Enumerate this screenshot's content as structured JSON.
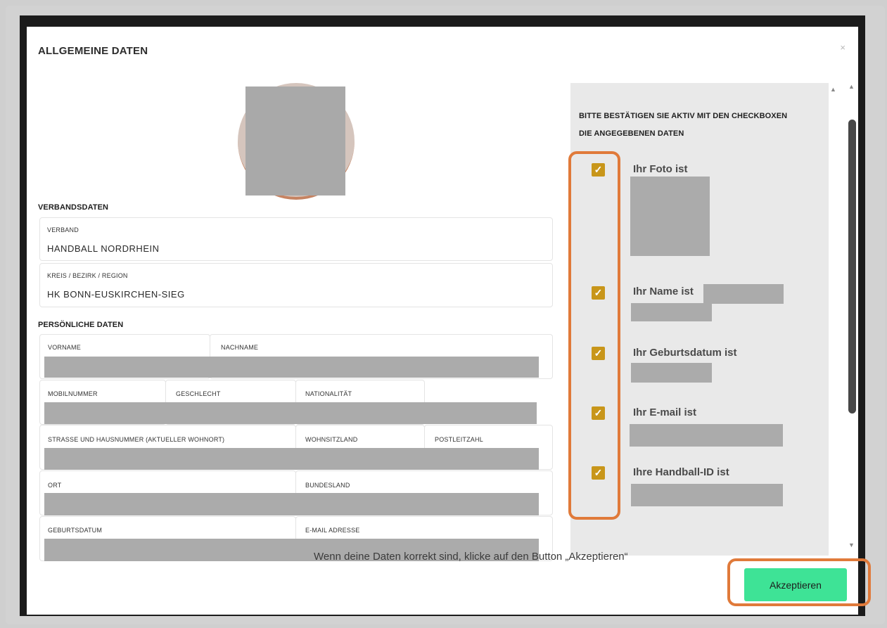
{
  "dialog": {
    "title": "ALLGEMEINE DATEN",
    "close_label": "×"
  },
  "verbandsdaten": {
    "heading": "VERBANDSDATEN",
    "verband_label": "VERBAND",
    "verband_value": "HANDBALL NORDRHEIN",
    "kreis_label": "KREIS / BEZIRK / REGION",
    "kreis_value": "HK BONN-EUSKIRCHEN-SIEG"
  },
  "persoenlich": {
    "heading": "PERSÖNLICHE DATEN",
    "vorname": "VORNAME",
    "nachname": "NACHNAME",
    "mobil": "MOBILNUMMER",
    "geschlecht": "GESCHLECHT",
    "nationalitaet": "NATIONALITÄT",
    "strasse": "STRASSE UND HAUSNUMMER (AKTUELLER WOHNORT)",
    "wohnsitzland": "WOHNSITZLAND",
    "plz": "POSTLEITZAHL",
    "ort": "ORT",
    "bundesland": "BUNDESLAND",
    "geburtsdatum": "GEBURTSDATUM",
    "email": "E-MAIL ADRESSE"
  },
  "bestaetigung": {
    "intro": "BITTE BESTÄTIGEN SIE AKTIV MIT DEN CHECKBOXEN DIE ANGEGEBENEN DATEN",
    "checkbox_mark": "✓",
    "items": [
      {
        "label": "Ihr Foto ist"
      },
      {
        "label": "Ihr Name ist"
      },
      {
        "label": "Ihr Geburtsdatum ist"
      },
      {
        "label": "Ihr E-mail ist"
      },
      {
        "label": "Ihre Handball-ID ist"
      }
    ]
  },
  "footer": {
    "hint": "Wenn deine Daten korrekt sind, klicke auf den Button „Akzeptieren“",
    "accept_label": "Akzeptieren"
  },
  "colors": {
    "accent_checkbox": "#c8961a",
    "accept_button": "#3ee396",
    "highlight": "#e07a3a"
  }
}
